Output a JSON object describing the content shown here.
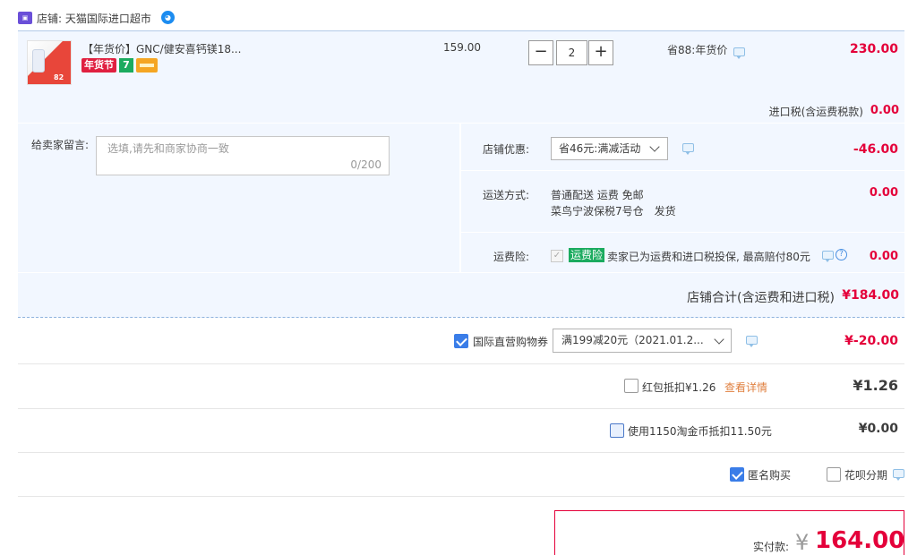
{
  "store": {
    "label": "店铺: 天猫国际进口超市",
    "icon": "tmall-store-icon",
    "chat_icon": "wangwang-chat-icon"
  },
  "item": {
    "title": "【年货价】GNC/健安喜钙镁18...",
    "badge_festival": "年货节",
    "badge_seven": "7",
    "thumb_tag": "82",
    "unit_price": "159.00",
    "quantity": "2",
    "minus": "−",
    "plus": "+",
    "discount_label": "省88:年货价",
    "total": "230.00"
  },
  "import_tax": {
    "label": "进口税(含运费税款)",
    "value": "0.00"
  },
  "seller_message": {
    "label": "给卖家留言:",
    "placeholder": "选填,请先和商家协商一致",
    "counter": "0/200"
  },
  "store_promo": {
    "label": "店铺优惠:",
    "selected": "省46元:满减活动",
    "value": "-46.00"
  },
  "shipping": {
    "label": "运送方式:",
    "line1": "普通配送 运费 免邮",
    "line2": "菜鸟宁波保税7号仓　发货",
    "value": "0.00"
  },
  "freight_insurance": {
    "label": "运费险:",
    "badge": "运费险",
    "check": "✓",
    "description": "卖家已为运费和进口税投保, 最高赔付80元",
    "help": "?",
    "value": "0.00"
  },
  "store_total": {
    "label": "店铺合计(含运费和进口税)",
    "value": "¥184.00"
  },
  "coupon": {
    "label": "国际直营购物券",
    "selected": "满199减20元（2021.01.2...",
    "value": "¥-20.00",
    "checked": true
  },
  "red_packet": {
    "label": "红包抵扣¥1.26",
    "link": "查看详情",
    "value": "¥1.26",
    "checked": false
  },
  "taobao_coins": {
    "label": "使用1150淘金币抵扣11.50元",
    "value": "¥0.00",
    "checked": false
  },
  "options": {
    "anonymous": "匿名购买",
    "anonymous_checked": true,
    "huabei": "花呗分期",
    "huabei_checked": false
  },
  "payment": {
    "label": "实付款:",
    "currency": "¥",
    "amount": "164.00"
  },
  "colors": {
    "accent_red": "#e4003a",
    "panel_bg": "#f2f7ff",
    "check_blue": "#3a7de8",
    "green_badge": "#1bab5f"
  }
}
